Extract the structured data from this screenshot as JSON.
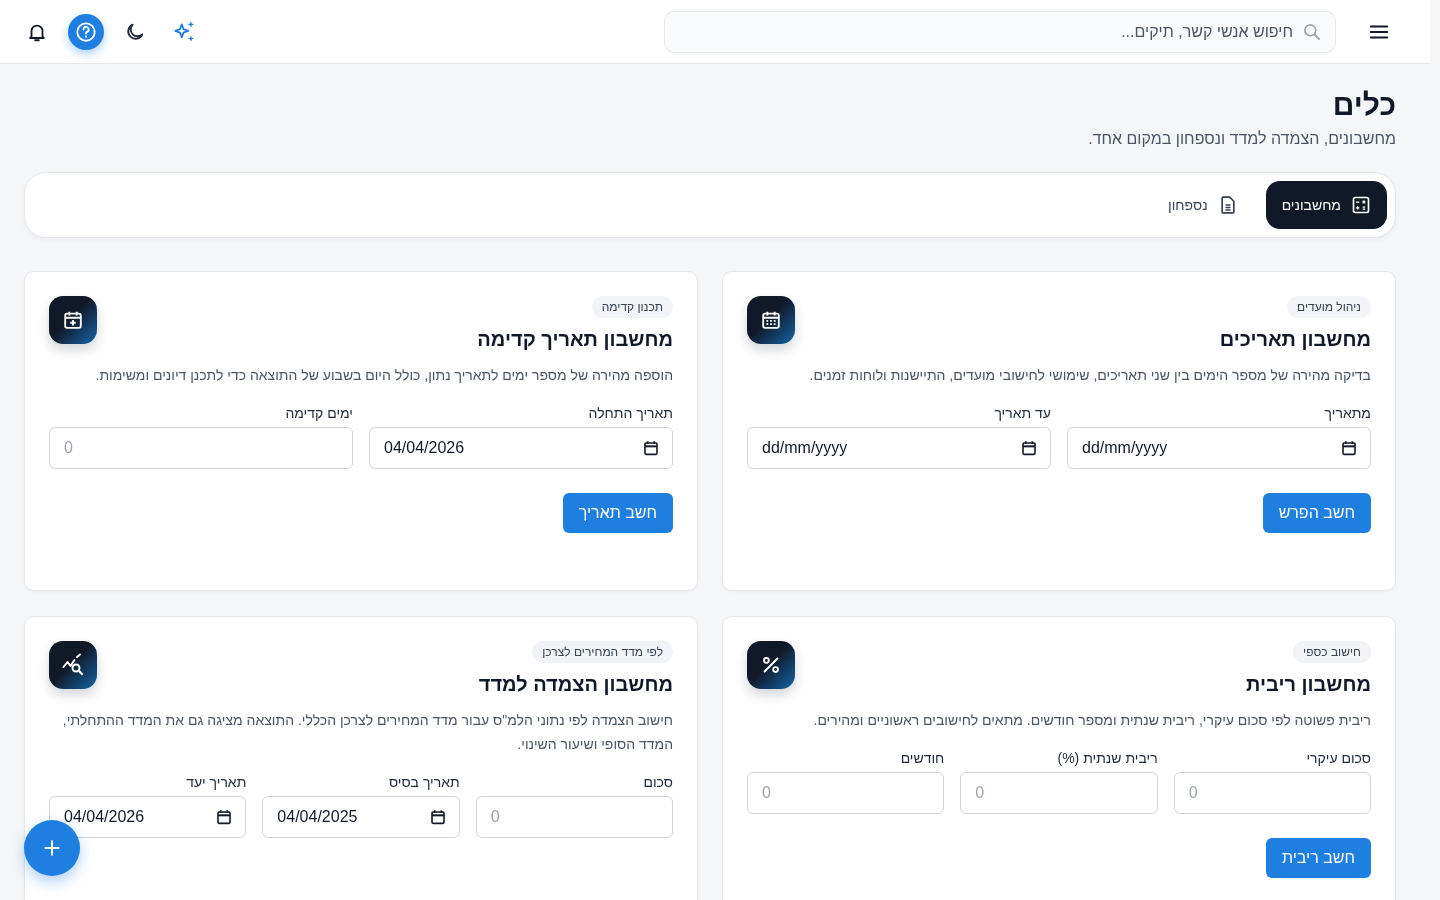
{
  "header": {
    "search": {
      "placeholder": "חיפוש אנשי קשר, תיקים..."
    }
  },
  "page": {
    "title": "כלים",
    "subtitle": "מחשבונים, הצמדה למדד ונספחון במקום אחד."
  },
  "tabs": [
    {
      "label": "מחשבונים",
      "kind": "calculator",
      "selected": true
    },
    {
      "label": "נספחון",
      "kind": "document",
      "selected": false
    }
  ],
  "cards": [
    {
      "tag": "ניהול מועדים",
      "title": "מחשבון תאריכים",
      "kind": "calendar",
      "description": "בדיקה מהירה של מספר הימים בין שני תאריכים, שימושי לחישובי מועדים, התיישנות ולוחות זמנים.",
      "fields": [
        {
          "label": "מתאריך",
          "kind": "date",
          "placeholder": "dd/mm/yyyy"
        },
        {
          "label": "עד תאריך",
          "kind": "date",
          "placeholder": "dd/mm/yyyy"
        }
      ],
      "button": "חשב הפרש"
    },
    {
      "tag": "תכנון קדימה",
      "title": "מחשבון תאריך קדימה",
      "kind": "calendar-plus",
      "description": "הוספה מהירה של מספר ימים לתאריך נתון, כולל היום בשבוע של התוצאה כדי לתכנן דיונים ומשימות.",
      "fields": [
        {
          "label": "תאריך התחלה",
          "kind": "date",
          "value": "04/04/2026"
        },
        {
          "label": "ימים קדימה",
          "kind": "number",
          "placeholder": "0"
        }
      ],
      "button": "חשב תאריך"
    },
    {
      "tag": "חישוב כספי",
      "title": "מחשבון ריבית",
      "kind": "percent",
      "description": "ריבית פשוטה לפי סכום עיקרי, ריבית שנתית ומספר חודשים. מתאים לחישובים ראשוניים ומהירים.",
      "fields": [
        {
          "label": "סכום עיקרי",
          "kind": "number",
          "placeholder": "0"
        },
        {
          "label": "ריבית שנתית (%)",
          "kind": "number",
          "placeholder": "0"
        },
        {
          "label": "חודשים",
          "kind": "number",
          "placeholder": "0"
        }
      ],
      "button": "חשב ריבית"
    },
    {
      "tag": "לפי מדד המחירים לצרכן",
      "title": "מחשבון הצמדה למדד",
      "kind": "chart",
      "description": "חישוב הצמדה לפי נתוני הלמ\"ס עבור מדד המחירים לצרכן הכללי. התוצאה מציגה גם את המדד ההתחלתי, המדד הסופי ושיעור השינוי.",
      "fields": [
        {
          "label": "סכום",
          "kind": "number",
          "placeholder": "0"
        },
        {
          "label": "תאריך בסיס",
          "kind": "date",
          "value": "04/04/2025"
        },
        {
          "label": "תאריך יעד",
          "kind": "date",
          "value": "04/04/2026"
        }
      ]
    }
  ]
}
